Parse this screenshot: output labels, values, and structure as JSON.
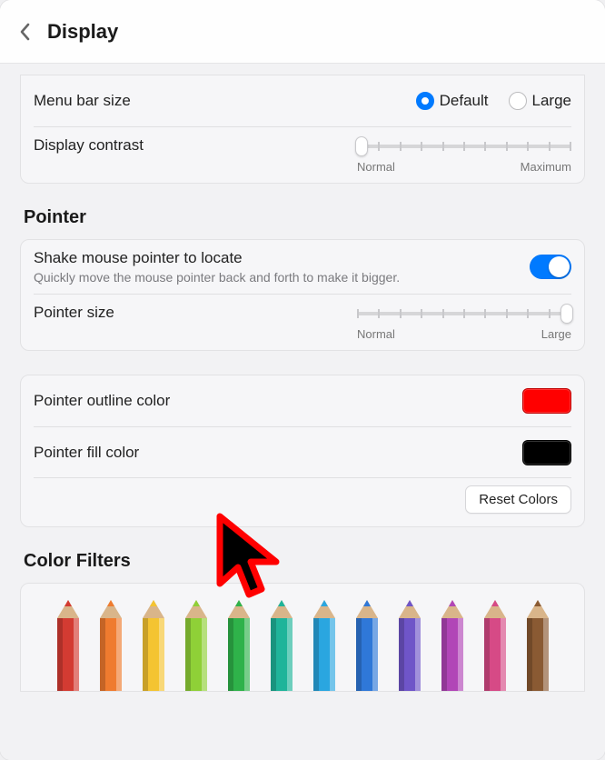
{
  "header": {
    "title": "Display"
  },
  "menuBar": {
    "label": "Menu bar size",
    "options": {
      "default": "Default",
      "large": "Large"
    },
    "selected": "default"
  },
  "contrast": {
    "label": "Display contrast",
    "min_label": "Normal",
    "max_label": "Maximum",
    "value_pct": 2
  },
  "pointerSection": {
    "title": "Pointer"
  },
  "shake": {
    "label": "Shake mouse pointer to locate",
    "sub": "Quickly move the mouse pointer back and forth to make it bigger.",
    "on": true
  },
  "pointerSize": {
    "label": "Pointer size",
    "min_label": "Normal",
    "max_label": "Large",
    "value_pct": 98
  },
  "outline": {
    "label": "Pointer outline color",
    "color": "#ff0000"
  },
  "fill": {
    "label": "Pointer fill color",
    "color": "#000000"
  },
  "reset": {
    "label": "Reset Colors"
  },
  "filters": {
    "title": "Color Filters"
  },
  "pencilColors": [
    "#d33b32",
    "#ef7b2f",
    "#f4c431",
    "#8fd037",
    "#2fb24a",
    "#1fb49a",
    "#2aa6e0",
    "#2f78d8",
    "#6f55c8",
    "#b146b7",
    "#d64a86",
    "#8a5a33"
  ]
}
